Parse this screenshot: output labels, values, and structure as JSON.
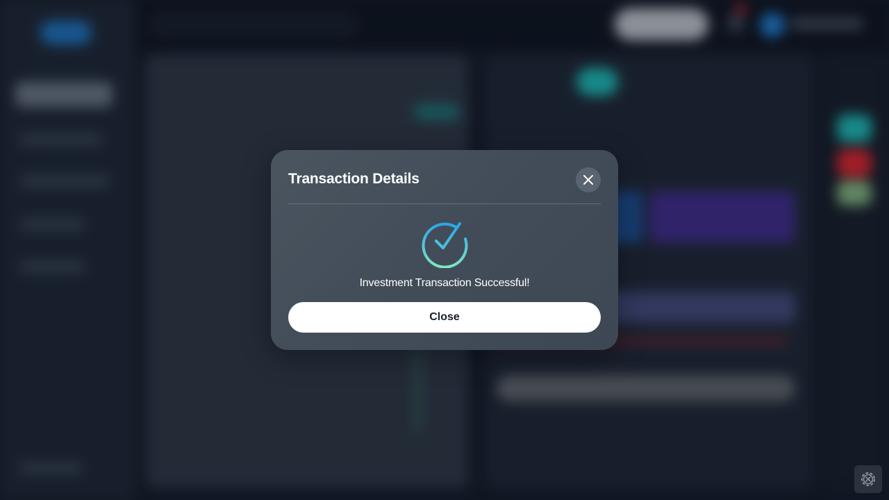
{
  "modal": {
    "title": "Transaction Details",
    "message": "Investment Transaction Successful!",
    "close_button_label": "Close",
    "close_icon": "close-icon",
    "status_icon": "check-circle-icon"
  },
  "settings_button": {
    "icon": "gear-icon"
  },
  "colors": {
    "accent_gradient_start": "#2aa7e6",
    "accent_gradient_end": "#7fe7c4",
    "modal_background": "#45505c",
    "button_background": "#ffffff"
  }
}
